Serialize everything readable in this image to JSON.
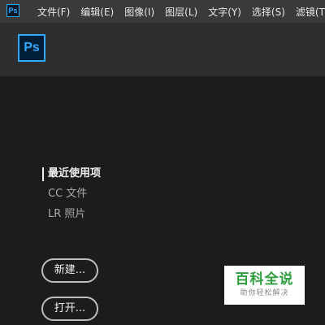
{
  "menubar": {
    "logo": "Ps",
    "items": [
      "文件(F)",
      "编辑(E)",
      "图像(I)",
      "图层(L)",
      "文字(Y)",
      "选择(S)",
      "滤镜(T)"
    ]
  },
  "header": {
    "logo": "Ps"
  },
  "nav": {
    "items": [
      {
        "label": "最近使用项",
        "active": true
      },
      {
        "label": "CC 文件",
        "active": false
      },
      {
        "label": "LR 照片",
        "active": false
      }
    ]
  },
  "buttons": {
    "new_label": "新建...",
    "open_label": "打开..."
  },
  "watermark": {
    "title": "百科全说",
    "subtitle": "助你轻松解决"
  },
  "colors": {
    "accent": "#31a8ff",
    "background": "#1c1c1c",
    "header": "#2e2e2e",
    "menubar": "#3a3a3a"
  }
}
